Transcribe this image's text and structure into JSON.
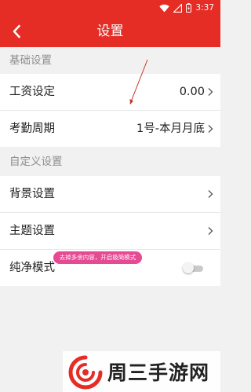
{
  "status_bar": {
    "time": "3:37"
  },
  "header": {
    "title": "设置"
  },
  "sections": {
    "basic": "基础设置",
    "custom": "自定义设置"
  },
  "rows": {
    "salary": {
      "label": "工资设定",
      "value": "0.00"
    },
    "attendance": {
      "label": "考勤周期",
      "value": "1号-本月月底"
    },
    "background": {
      "label": "背景设置"
    },
    "theme": {
      "label": "主题设置"
    },
    "pure_mode": {
      "label": "纯净模式",
      "enabled": false
    }
  },
  "tooltip": {
    "text": "去掉多余内容，开启极简模式"
  },
  "watermark": {
    "text": "周三手游网"
  },
  "colors": {
    "accent": "#e52d26",
    "tooltip": "#e54a93"
  },
  "icons": [
    "wifi-icon",
    "signal-icon",
    "battery-icon",
    "back-arrow-icon",
    "chevron-right-icon",
    "watermark-logo-icon"
  ]
}
